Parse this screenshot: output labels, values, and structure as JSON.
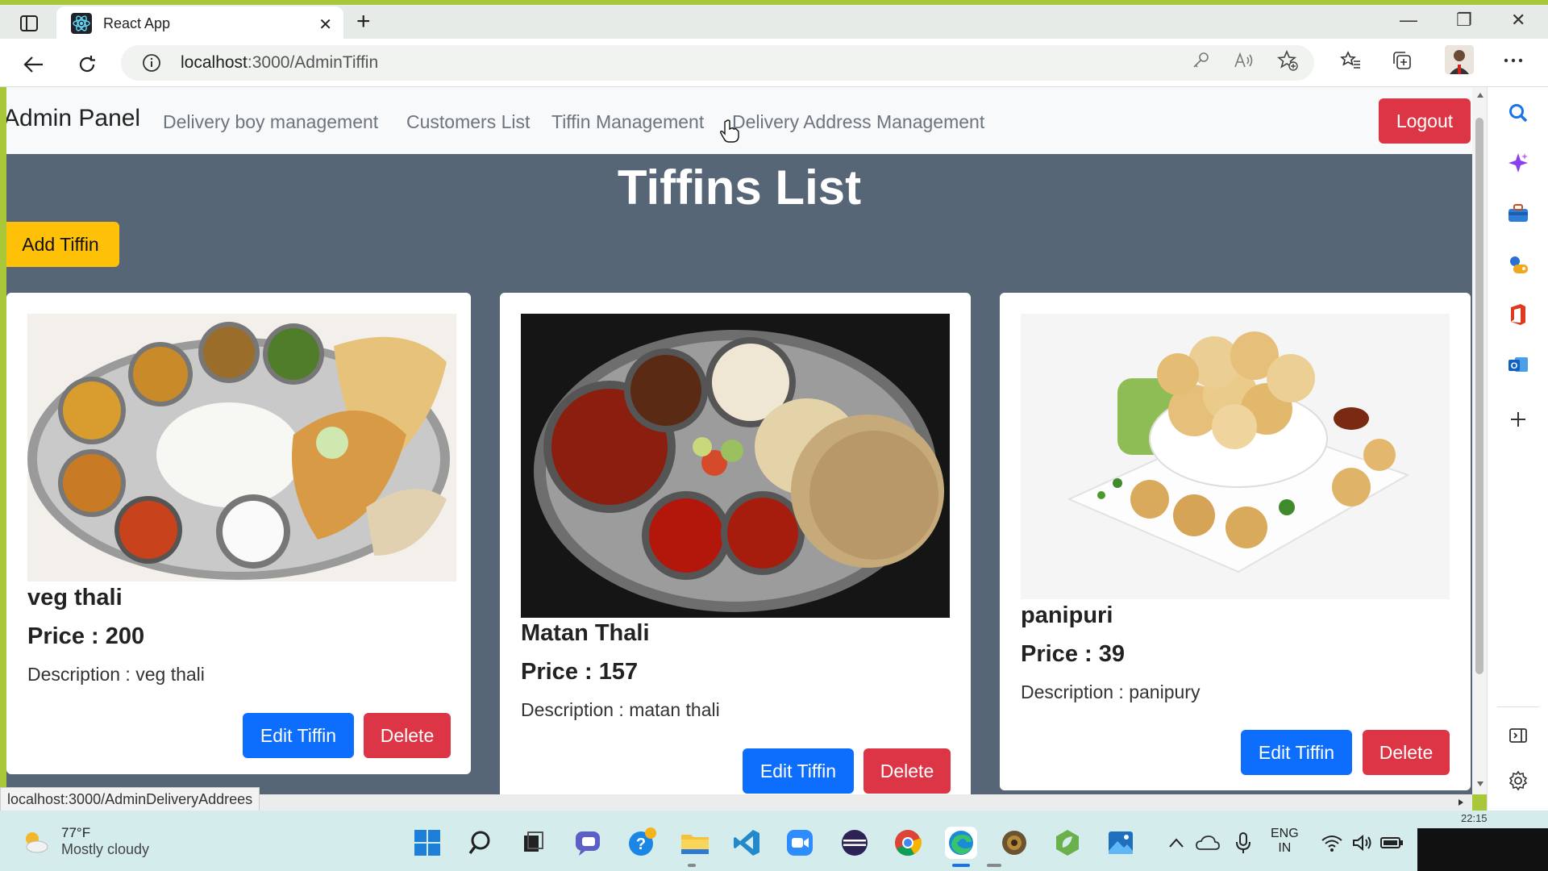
{
  "browser": {
    "tab_title": "React App",
    "tab_close": "✕",
    "new_tab": "+",
    "url_host": "localhost",
    "url_path": ":3000/AdminTiffin",
    "window_controls": [
      "—",
      "❐",
      "✕"
    ]
  },
  "navbar": {
    "brand": "Admin Panel",
    "links": [
      "Delivery boy management",
      "Customers List",
      "Tiffin Management",
      "Delivery Address Management"
    ],
    "logout": "Logout"
  },
  "page": {
    "title": "Tiffins List",
    "add_button": "Add Tiffin"
  },
  "tiffins": [
    {
      "name": "veg thali",
      "price": "Price : 200",
      "description": "Description : veg thali",
      "edit": "Edit Tiffin",
      "delete": "Delete"
    },
    {
      "name": "Matan Thali",
      "price": "Price : 157",
      "description": "Description : matan thali",
      "edit": "Edit Tiffin",
      "delete": "Delete"
    },
    {
      "name": "panipuri",
      "price": "Price : 39",
      "description": "Description : panipury",
      "edit": "Edit Tiffin",
      "delete": "Delete"
    }
  ],
  "status_bar": {
    "hover_url": "localhost:3000/AdminDeliveryAddrees"
  },
  "taskbar": {
    "weather_temp": "77°F",
    "weather_cond": "Mostly cloudy",
    "lang_1": "ENG",
    "lang_2": "IN",
    "clock_partial": "22:15"
  },
  "colors": {
    "page_bg": "#566677",
    "primary": "#0d6efd",
    "danger": "#dc3545",
    "warning": "#ffc107"
  }
}
